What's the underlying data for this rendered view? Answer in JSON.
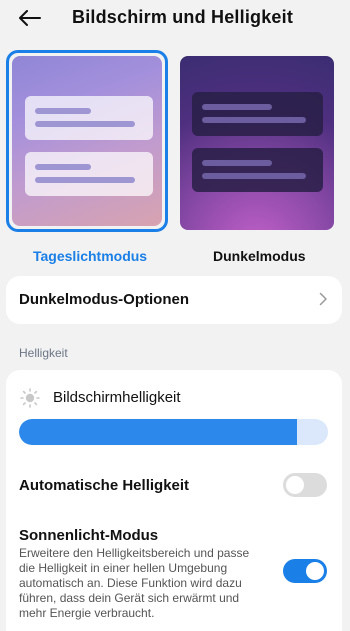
{
  "header": {
    "title": "Bildschirm und Helligkeit",
    "back_icon": "arrow-left-icon"
  },
  "modes": {
    "light_label": "Tageslichtmodus",
    "dark_label": "Dunkelmodus",
    "selected": "light",
    "accent_color": "#1a7fe6"
  },
  "options": {
    "label": "Dunkelmodus-Optionen",
    "icon": "chevron-right-icon"
  },
  "brightness_section": {
    "heading": "Helligkeit",
    "brightness_label": "Bildschirmhelligkeit",
    "brightness_value": 0.9,
    "auto_label": "Automatische Helligkeit",
    "auto_enabled": false,
    "sunlight_title": "Sonnenlicht-Modus",
    "sunlight_desc": "Erweitere den Helligkeitsbereich und passe die Helligkeit in einer hellen Umgebung automatisch an. Diese Funktion wird dazu führen, dass dein Gerät sich erwärmt und mehr Energie verbraucht.",
    "sunlight_enabled": true
  }
}
